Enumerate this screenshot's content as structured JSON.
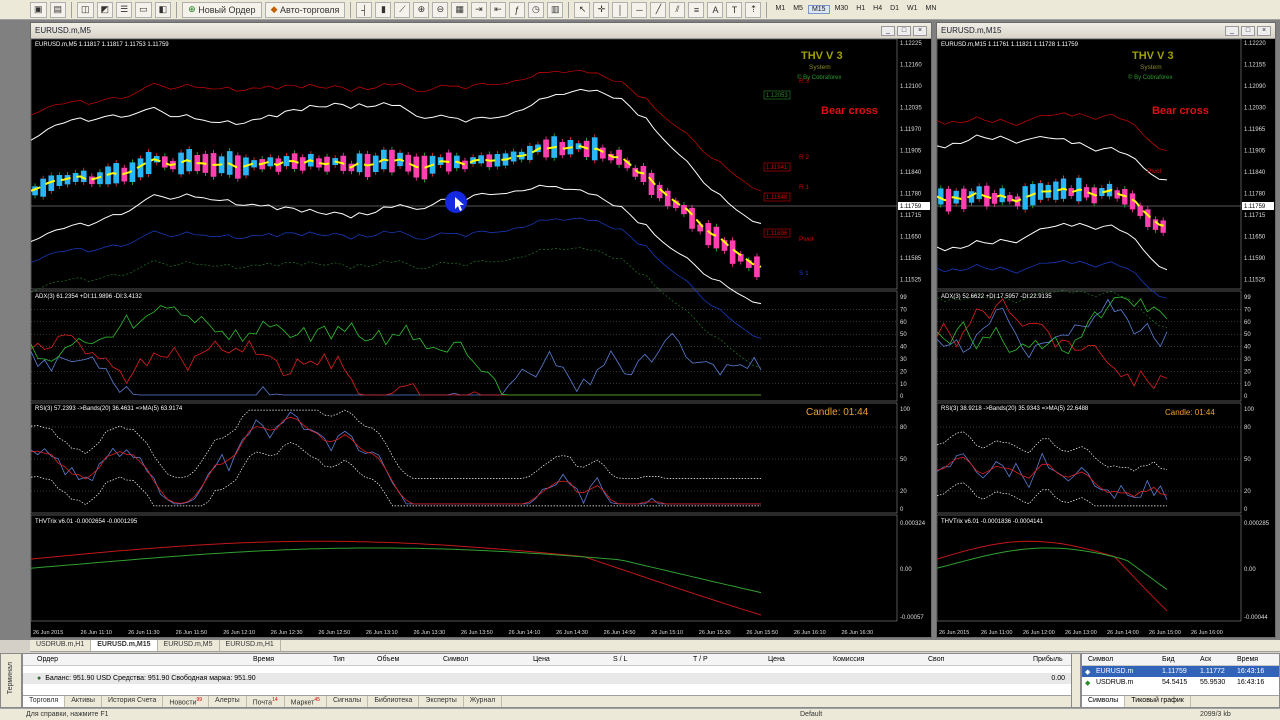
{
  "toolbar": {
    "new_order": "Новый Ордер",
    "autotrading": "Авто-торговля",
    "timeframes": [
      "M1",
      "M5",
      "M15",
      "M30",
      "H1",
      "H4",
      "D1",
      "W1",
      "MN"
    ],
    "active_timeframe": "M15"
  },
  "windows": {
    "main_title": "EURUSD.m,M5",
    "side_title": "EURUSD.m,M15"
  },
  "main_chart": {
    "header": "EURUSD.m,M5  1.11817 1.11817 1.11753 1.11759",
    "logo_title": "THV V 3",
    "logo_sub": "System",
    "logo_by": "© By Cobraforex",
    "bear_cross": "Bear cross",
    "price_labels": [
      "1.12225",
      "1.12160",
      "1.12100",
      "1.12035",
      "1.11970",
      "1.11905",
      "1.11840",
      "1.11780",
      "1.11715",
      "1.11650",
      "1.11585",
      "1.11525"
    ],
    "current_price": "1.11759",
    "pivot_boxes": [
      "1.12053",
      "1.11941",
      "1.11848",
      "1.11696"
    ],
    "pivot_text": [
      "R 3",
      "R 2",
      "R 1",
      "Pivot",
      "S 1"
    ],
    "adx_header": "ADX(3) 61.2354 +DI:11.9896 -DI:3.4132",
    "adx_levels": [
      "99",
      "70",
      "60",
      "50",
      "40",
      "30",
      "20",
      "10",
      "0"
    ],
    "rsi_header": "RSI(3) 57.2393 ->Bands(20) 36.4631 =>MA(5) 63.9174",
    "rsi_levels": [
      "100",
      "80",
      "50",
      "20",
      "0"
    ],
    "candle_label": "Candle:  01:44",
    "trix_header": "THVTrix v6.01 -0.0002654 -0.0001295",
    "trix_levels": [
      "0.000324",
      "0.00",
      "-0.00057"
    ],
    "time_labels": [
      "26 Jun 2015",
      "26 Jun 11:10",
      "26 Jun 11:30",
      "26 Jun 11:50",
      "26 Jun 12:10",
      "26 Jun 12:30",
      "26 Jun 12:50",
      "26 Jun 13:10",
      "26 Jun 13:30",
      "26 Jun 13:50",
      "26 Jun 14:10",
      "26 Jun 14:30",
      "26 Jun 14:50",
      "26 Jun 15:10",
      "26 Jun 15:30",
      "26 Jun 15:50",
      "26 Jun 16:10",
      "26 Jun 16:30"
    ]
  },
  "side_chart": {
    "header": "EURUSD.m,M15  1.11761 1.11821 1.11728 1.11759",
    "logo_title": "THV V 3",
    "logo_sub": "System",
    "logo_by": "© By Cobraforex",
    "bear_cross": "Bear cross",
    "pivot_label": "Pivot",
    "price_labels": [
      "1.12220",
      "1.12155",
      "1.12090",
      "1.12030",
      "1.11965",
      "1.11905",
      "1.11840",
      "1.11780",
      "1.11715",
      "1.11650",
      "1.11590",
      "1.11525"
    ],
    "current_price": "1.11759",
    "adx_header": "ADX(3) 52.6622 +DI:17.5957 -DI:22.9135",
    "adx_levels": [
      "99",
      "70",
      "60",
      "50",
      "40",
      "30",
      "20",
      "10",
      "0"
    ],
    "rsi_header": "RSI(3) 38.9218 ->Bands(20) 35.9343 =>MA(5) 22.6488",
    "rsi_levels": [
      "100",
      "80",
      "50",
      "20",
      "0"
    ],
    "candle_label": "Candle:  01:44",
    "trix_header": "THVTrix v6.01 -0.0001836 -0.0004141",
    "trix_levels": [
      "0.000285",
      "0.00",
      "-0.00044"
    ],
    "time_labels": [
      "26 Jun 2015",
      "26 Jun 11:00",
      "26 Jun 12:00",
      "26 Jun 13:00",
      "26 Jun 14:00",
      "26 Jun 15:00",
      "26 Jun 16:00"
    ]
  },
  "chart_tabs": [
    "USDRUB.m,H1",
    "EURUSD.m,M15",
    "EURUSD.m,M5",
    "EURUSD.m,H1"
  ],
  "active_chart_tab": "EURUSD.m,M15",
  "terminal": {
    "side_label": "Терминал",
    "columns": [
      "Ордер",
      "Время",
      "Тип",
      "Объем",
      "Символ",
      "Цена",
      "S / L",
      "T / P",
      "Цена",
      "Комиссия",
      "Своп",
      "Прибыль"
    ],
    "balance": "Баланс: 951.90 USD  Средства: 951.90  Свободная маржа: 951.90",
    "profit": "0.00",
    "tabs": [
      "Торговля",
      "Активы",
      "История Счета",
      "Новости",
      "Алерты",
      "Почта",
      "Маркет",
      "Сигналы",
      "Библиотека",
      "Эксперты",
      "Журнал"
    ],
    "tab_badges": {
      "Новости": "99",
      "Почта": "14",
      "Маркет": "45"
    }
  },
  "market_watch": {
    "side_label": "16:43:16",
    "columns": [
      "Символ",
      "Бид",
      "Аск",
      "Время"
    ],
    "rows": [
      {
        "symbol": "EURUSD.m",
        "bid": "1.11759",
        "ask": "1.11772",
        "time": "16:43:16"
      },
      {
        "symbol": "USDRUB.m",
        "bid": "54.5415",
        "ask": "55.9530",
        "time": "16:43:16"
      }
    ],
    "tabs": [
      "Символы",
      "Тиковый график"
    ]
  },
  "status": {
    "help": "Для справки, нажмите F1",
    "profile": "Default",
    "traffic": "2099/3 kb"
  },
  "colors": {
    "bg": "#000000",
    "bull": "#29b6f6",
    "bear": "#ff3fb0",
    "sma": "#ffff00",
    "adx": "#5b7fd6",
    "red": "#e02020",
    "green": "#30c030",
    "pivot": "#d00000",
    "support": "#1a3fd0",
    "gold": "#a0a000",
    "candle_text": "#f0a030"
  }
}
